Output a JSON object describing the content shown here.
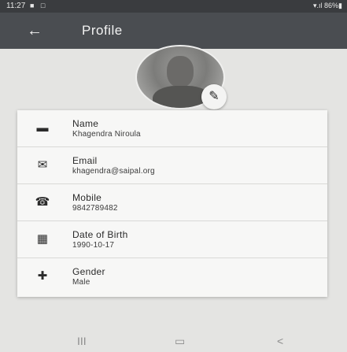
{
  "status_bar": {
    "time": "11:27",
    "left_icons": "■ □",
    "right_text": "▾.ıl 86%▮"
  },
  "app_bar": {
    "back_icon": "arrow-back-icon",
    "back_glyph": "←",
    "title": "Profile"
  },
  "avatar": {
    "edit_icon": "pencil-icon",
    "edit_glyph": "✎"
  },
  "fields": [
    {
      "icon": "person-icon",
      "glyph": "▬",
      "label": "Name",
      "value": "Khagendra Niroula"
    },
    {
      "icon": "mail-icon",
      "glyph": "✉",
      "label": "Email",
      "value": "khagendra@saipal.org"
    },
    {
      "icon": "phone-icon",
      "glyph": "☎",
      "label": "Mobile",
      "value": "9842789482"
    },
    {
      "icon": "calendar-icon",
      "glyph": "▦",
      "label": "Date of Birth",
      "value": "1990-10-17"
    },
    {
      "icon": "gender-icon",
      "glyph": "✚",
      "label": "Gender",
      "value": "Male"
    }
  ],
  "nav_bar": {
    "recents_glyph": "III",
    "home_glyph": "▭",
    "back_glyph": "<"
  }
}
